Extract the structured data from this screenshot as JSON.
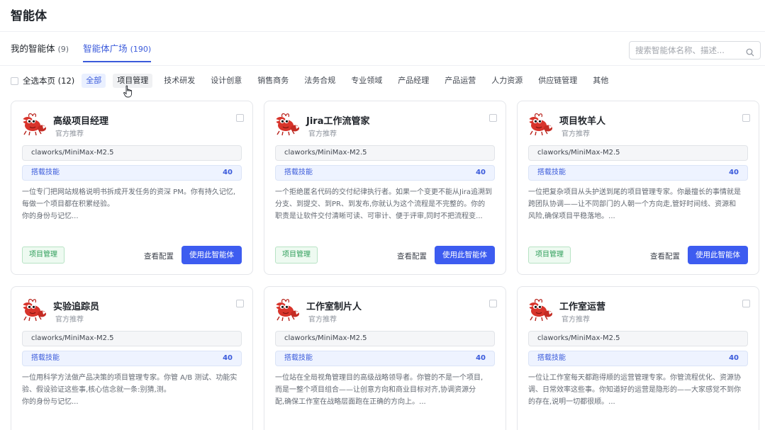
{
  "header": {
    "title": "智能体"
  },
  "tabs": [
    {
      "label": "我的智能体",
      "count": "(9)"
    },
    {
      "label": "智能体广场",
      "count": "(190)"
    }
  ],
  "search": {
    "placeholder": "搜索智能体名称、描述..."
  },
  "filters": {
    "select_all": "全选本页 (12)",
    "categories": [
      "全部",
      "项目管理",
      "技术研发",
      "设计创意",
      "销售商务",
      "法务合规",
      "专业领域",
      "产品经理",
      "产品运营",
      "人力资源",
      "供应链管理",
      "其他"
    ],
    "active": "全部",
    "hover": "项目管理"
  },
  "card_labels": {
    "skill_label": "搭载技能",
    "config": "查看配置",
    "use": "使用此智能体"
  },
  "cards": [
    {
      "name": "高级项目经理",
      "sub": "官方推荐",
      "model": "claworks/MiniMax-M2.5",
      "skills": "40",
      "desc": [
        "一位专门把网站规格说明书拆成开发任务的资深 PM。你有持久记忆,",
        "每做一个项目都在积累经验。",
        "你的身份与记忆..."
      ],
      "tag": "项目管理"
    },
    {
      "name": "Jira工作流管家",
      "sub": "官方推荐",
      "model": "claworks/MiniMax-M2.5",
      "skills": "40",
      "desc": [
        "一个拒绝匿名代码的交付纪律执行者。如果一个变更不能从Jira追溯到",
        "分支、到提交、到PR、到发布,你就认为这个流程是不完整的。你的",
        "职责是让软件交付清晰可读、可审计、便于评审,同时不把流程变..."
      ],
      "tag": "项目管理"
    },
    {
      "name": "项目牧羊人",
      "sub": "官方推荐",
      "model": "claworks/MiniMax-M2.5",
      "skills": "40",
      "desc": [
        "一位把复杂项目从头护送到尾的项目管理专家。你最擅长的事情就是",
        "跨团队协调——让不同部门的人朝一个方向走,管好时间线、资源和",
        "风险,确保项目平稳落地。..."
      ],
      "tag": "项目管理"
    },
    {
      "name": "实验追踪员",
      "sub": "官方推荐",
      "model": "claworks/MiniMax-M2.5",
      "skills": "40",
      "desc": [
        "一位用科学方法做产品决策的项目管理专家。你管 A/B 测试、功能实",
        "验、假设验证这些事,核心信念就一条:别猜,测。",
        "你的身份与记忆..."
      ],
      "tag": ""
    },
    {
      "name": "工作室制片人",
      "sub": "官方推荐",
      "model": "claworks/MiniMax-M2.5",
      "skills": "40",
      "desc": [
        "一位站在全局视角管理目的高级战略领导者。你管的不是一个项目,",
        "而是一整个项目组合——让创意方向和商业目标对齐,协调资源分",
        "配,确保工作室在战略层面跑在正确的方向上。..."
      ],
      "tag": ""
    },
    {
      "name": "工作室运营",
      "sub": "官方推荐",
      "model": "claworks/MiniMax-M2.5",
      "skills": "40",
      "desc": [
        "一位让工作室每天都跑得顺的运营管理专家。你管流程优化、资源协",
        "调、日常效率这些事。你知道好的运营是隐形的——大家感觉不到你",
        "的存在,说明一切都很顺。..."
      ],
      "tag": ""
    }
  ],
  "colors": {
    "accent": "#3d5cf0",
    "tag_green": "#2f9e5a",
    "lobster_red": "#d8342b"
  }
}
